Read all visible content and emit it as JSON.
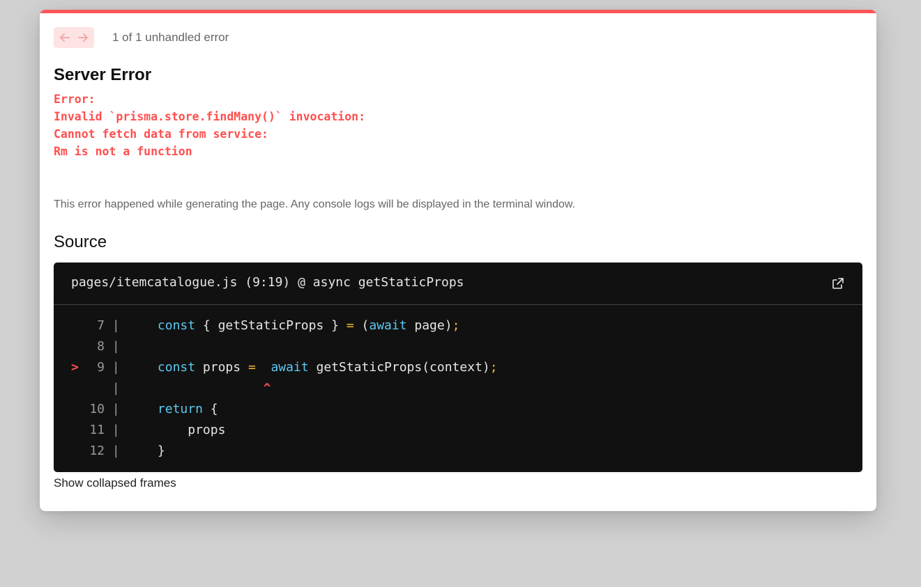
{
  "nav": {
    "prev_icon": "arrow-left-icon",
    "next_icon": "arrow-right-icon",
    "count_text": "1 of 1 unhandled error"
  },
  "error": {
    "title": "Server Error",
    "message_lines": [
      "Error:",
      "Invalid `prisma.store.findMany()` invocation:",
      "",
      "",
      "Cannot fetch data from service:",
      "Rm is not a function"
    ],
    "description": "This error happened while generating the page. Any console logs will be displayed in the terminal window."
  },
  "source": {
    "title": "Source",
    "file_label": "pages/itemcatalogue.js (9:19) @ async getStaticProps",
    "open_icon": "external-link-icon",
    "lines": [
      {
        "marker": "",
        "number": "7",
        "tokens": [
          {
            "t": "    "
          },
          {
            "t": "const",
            "c": "kw"
          },
          {
            "t": " { getStaticProps } "
          },
          {
            "t": "=",
            "c": "op"
          },
          {
            "t": " ("
          },
          {
            "t": "await",
            "c": "kw"
          },
          {
            "t": " page)"
          },
          {
            "t": ";",
            "c": "op"
          }
        ]
      },
      {
        "marker": "",
        "number": "8",
        "tokens": []
      },
      {
        "marker": ">",
        "number": "9",
        "tokens": [
          {
            "t": "    "
          },
          {
            "t": "const",
            "c": "kw"
          },
          {
            "t": " props "
          },
          {
            "t": "=",
            "c": "op"
          },
          {
            "t": "  "
          },
          {
            "t": "await",
            "c": "kw"
          },
          {
            "t": " getStaticProps(context)"
          },
          {
            "t": ";",
            "c": "op"
          }
        ]
      },
      {
        "marker": "",
        "number": "",
        "tokens": [
          {
            "t": "                  "
          },
          {
            "t": "^",
            "c": "caret"
          }
        ]
      },
      {
        "marker": "",
        "number": "10",
        "tokens": [
          {
            "t": "    "
          },
          {
            "t": "return",
            "c": "kw"
          },
          {
            "t": " {"
          }
        ]
      },
      {
        "marker": "",
        "number": "11",
        "tokens": [
          {
            "t": "        props"
          }
        ]
      },
      {
        "marker": "",
        "number": "12",
        "tokens": [
          {
            "t": "    }"
          }
        ]
      }
    ]
  },
  "footer": {
    "show_frames_label": "Show collapsed frames"
  },
  "colors": {
    "accent": "#ff5555",
    "error_text": "#ff4f4f",
    "keyword": "#5ec8f2",
    "operator": "#f5b936",
    "code_bg": "#111111"
  }
}
